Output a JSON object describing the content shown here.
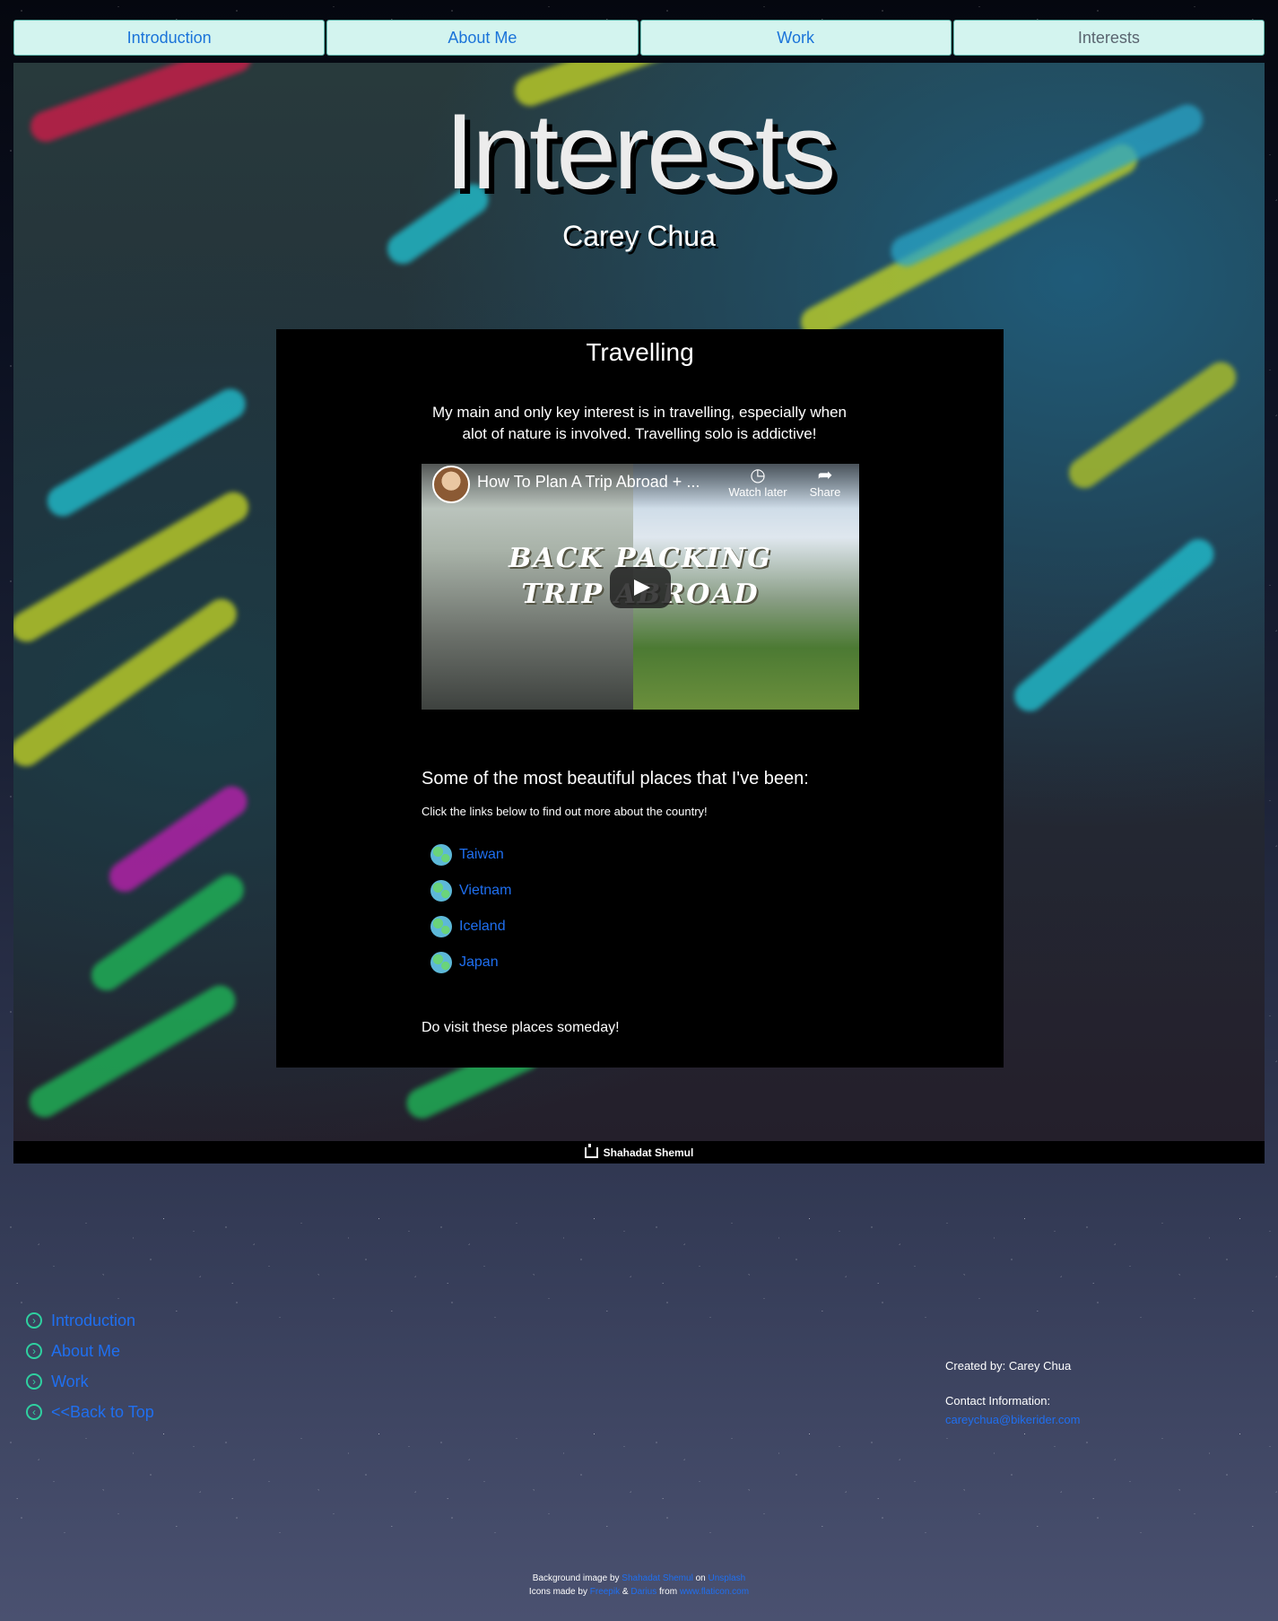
{
  "nav": {
    "tabs": [
      {
        "label": "Introduction"
      },
      {
        "label": "About Me"
      },
      {
        "label": "Work"
      },
      {
        "label": "Interests"
      }
    ],
    "active_tab": "Interests"
  },
  "hero": {
    "title": "Interests",
    "subtitle": "Carey Chua"
  },
  "panel": {
    "heading": "Travelling",
    "intro": "My main and only key interest is in travelling, especially when alot of nature is involved. Travelling solo is addictive!",
    "video": {
      "title": "How To Plan A Trip Abroad + ...",
      "watch_later": "Watch later",
      "share": "Share",
      "overlay_line1": "BACK PACKING",
      "overlay_line2": "TRIP ABROAD"
    },
    "places_heading": "Some of the most beautiful places that I've been:",
    "places_note": "Click the links below to find out more about the country!",
    "places": [
      "Taiwan",
      "Vietnam",
      "Iceland",
      "Japan"
    ],
    "outro": "Do visit these places someday!"
  },
  "photo_credit": "Shahadat Shemul",
  "bottom_nav": [
    "Introduction",
    "About Me",
    "Work",
    "<<Back to Top"
  ],
  "credits": {
    "created_by": "Created by: Carey Chua",
    "contact_label": "Contact Information:",
    "email": "careychua@bikerider.com"
  },
  "attribution": {
    "line1_prefix": "Background image by",
    "line1_author": "Shahadat Shemul",
    "line1_on": "on",
    "line1_site": "Unsplash",
    "line2_prefix": "Icons made by",
    "line2_a": "Freepik",
    "line2_amp": "&",
    "line2_b": "Darius",
    "line2_from": "from",
    "line2_site": "www.flaticon.com"
  },
  "colors": {
    "nav_bg": "#d3f4ef",
    "link": "#1f6ff0",
    "accent": "#2fd0a0",
    "panel_bg": "#000000"
  }
}
